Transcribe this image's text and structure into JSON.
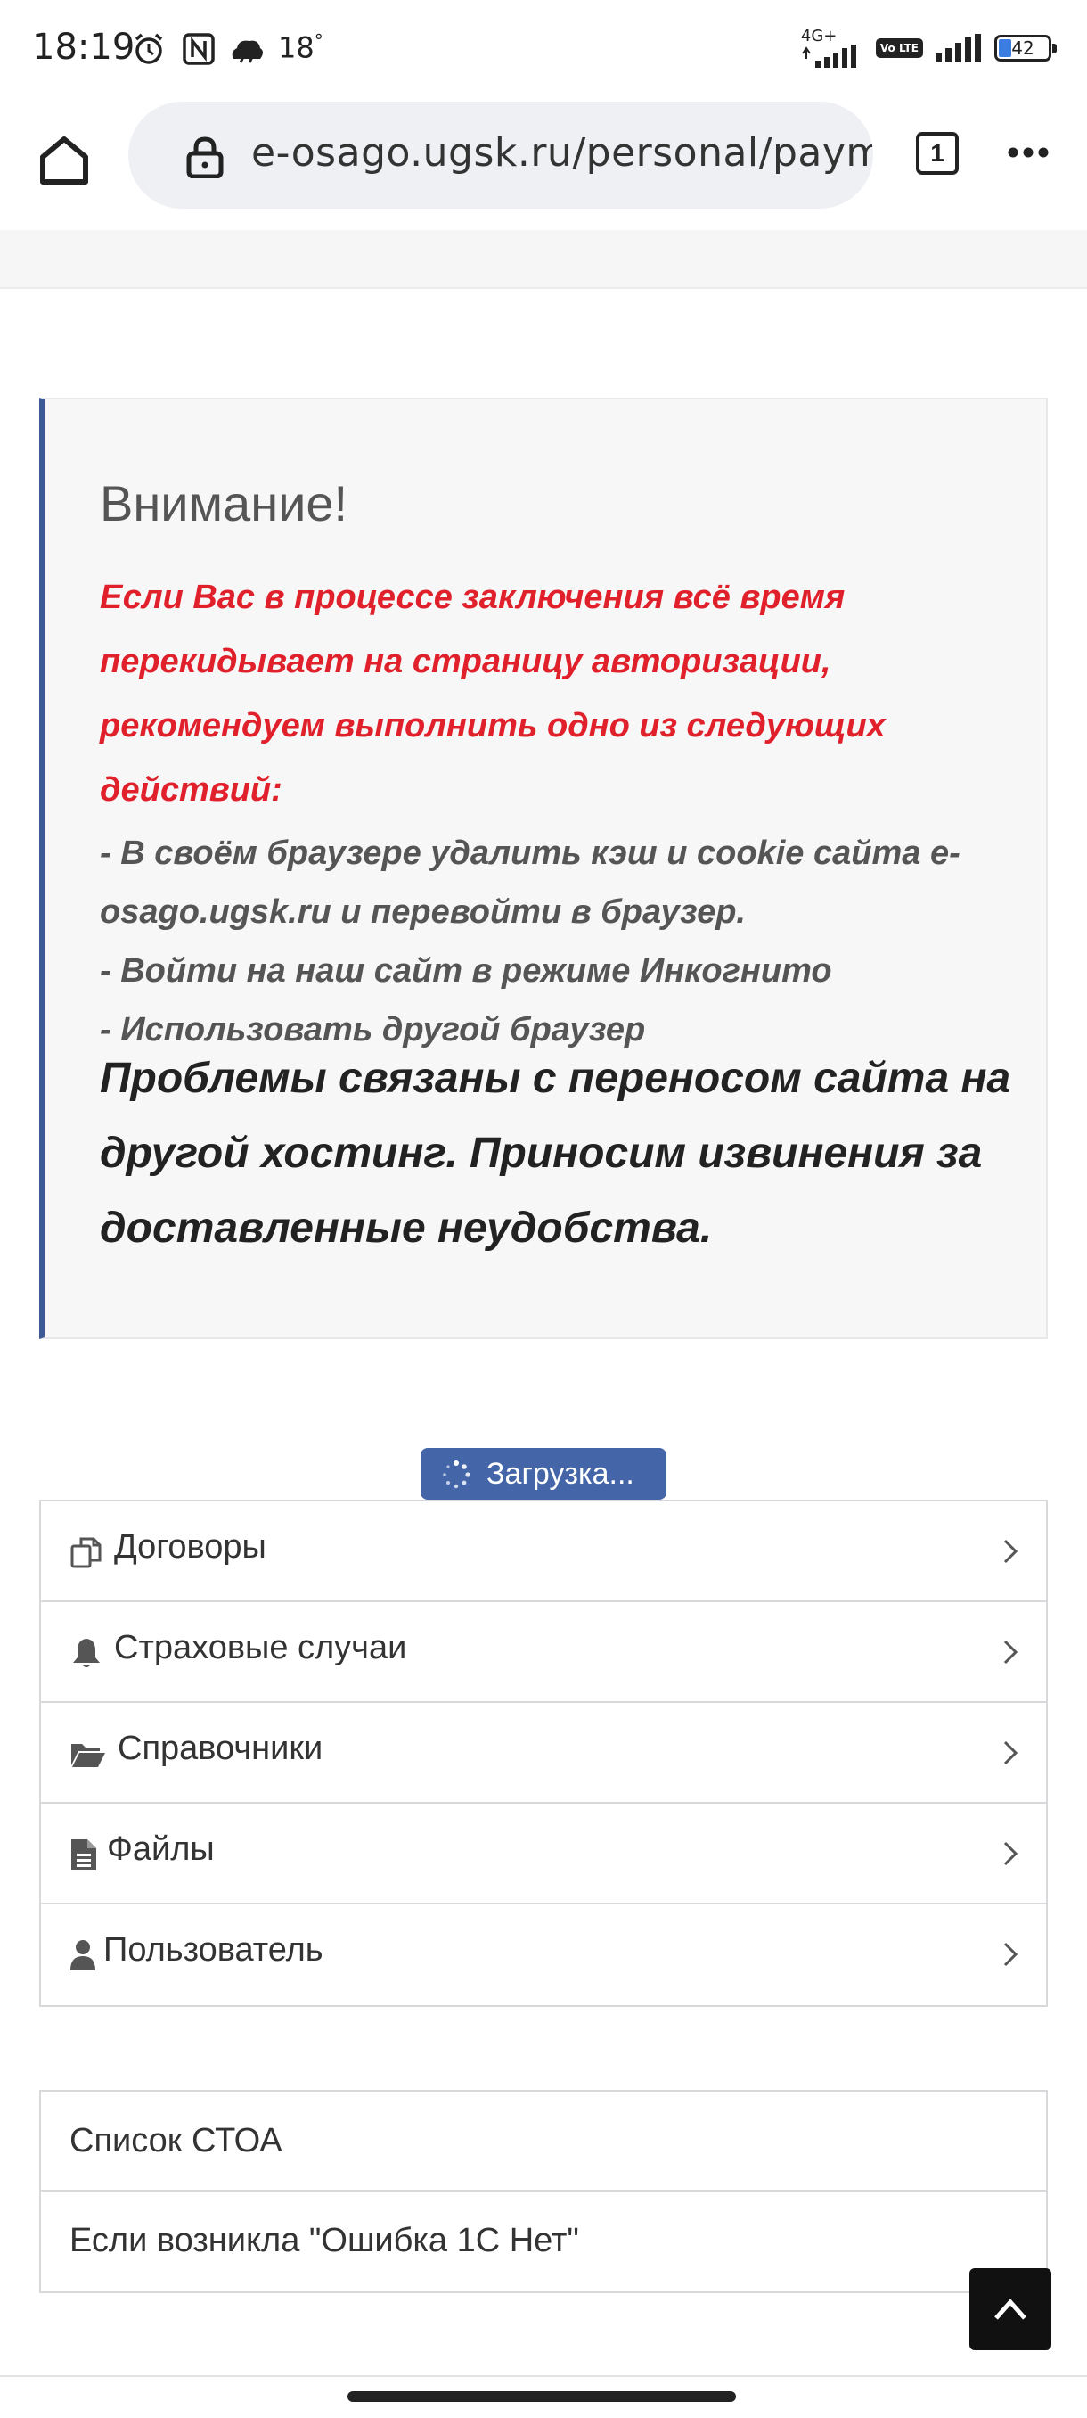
{
  "status_bar": {
    "time": "18:19",
    "temperature": "18",
    "temperature_unit": "°",
    "network_label": "4G+",
    "volte_label": "Vo LTE",
    "battery": "42",
    "icons": [
      "alarm-icon",
      "nfc-icon",
      "weather-icon",
      "signal-icon",
      "battery-icon"
    ]
  },
  "browser": {
    "url": "e-osago.ugsk.ru/personal/paym",
    "tab_count": "1"
  },
  "alert": {
    "title": "Внимание!",
    "warning": "Если Вас в процессе заключения всё время перекидывает на страницу авторизации, рекомендуем выполнить одно из следующих действий:",
    "steps": [
      "- В своём браузере удалить кэш и cookie сайта e-osago.ugsk.ru и перевойти в браузер.",
      "- Войти на наш сайт в режиме Инкогнито",
      "- Использовать другой браузер"
    ],
    "apology": "Проблемы связаны с переносом сайта на другой хостинг. Приносим извинения за доставленные неудобства.",
    "accent_color": "#e0202a",
    "border_color": "#3d5a96"
  },
  "loading": {
    "label": "Загрузка...",
    "color": "#4466a8"
  },
  "menu": {
    "items": [
      {
        "label": "Договоры",
        "icon": "copy-icon"
      },
      {
        "label": "Страховые случаи",
        "icon": "bell-icon"
      },
      {
        "label": "Справочники",
        "icon": "folder-open-icon"
      },
      {
        "label": "Файлы",
        "icon": "file-icon"
      },
      {
        "label": "Пользователь",
        "icon": "user-icon"
      }
    ]
  },
  "links": {
    "items": [
      {
        "label": "Список СТОА"
      },
      {
        "label": "Если возникла \"Ошибка 1С Нет\""
      }
    ]
  }
}
